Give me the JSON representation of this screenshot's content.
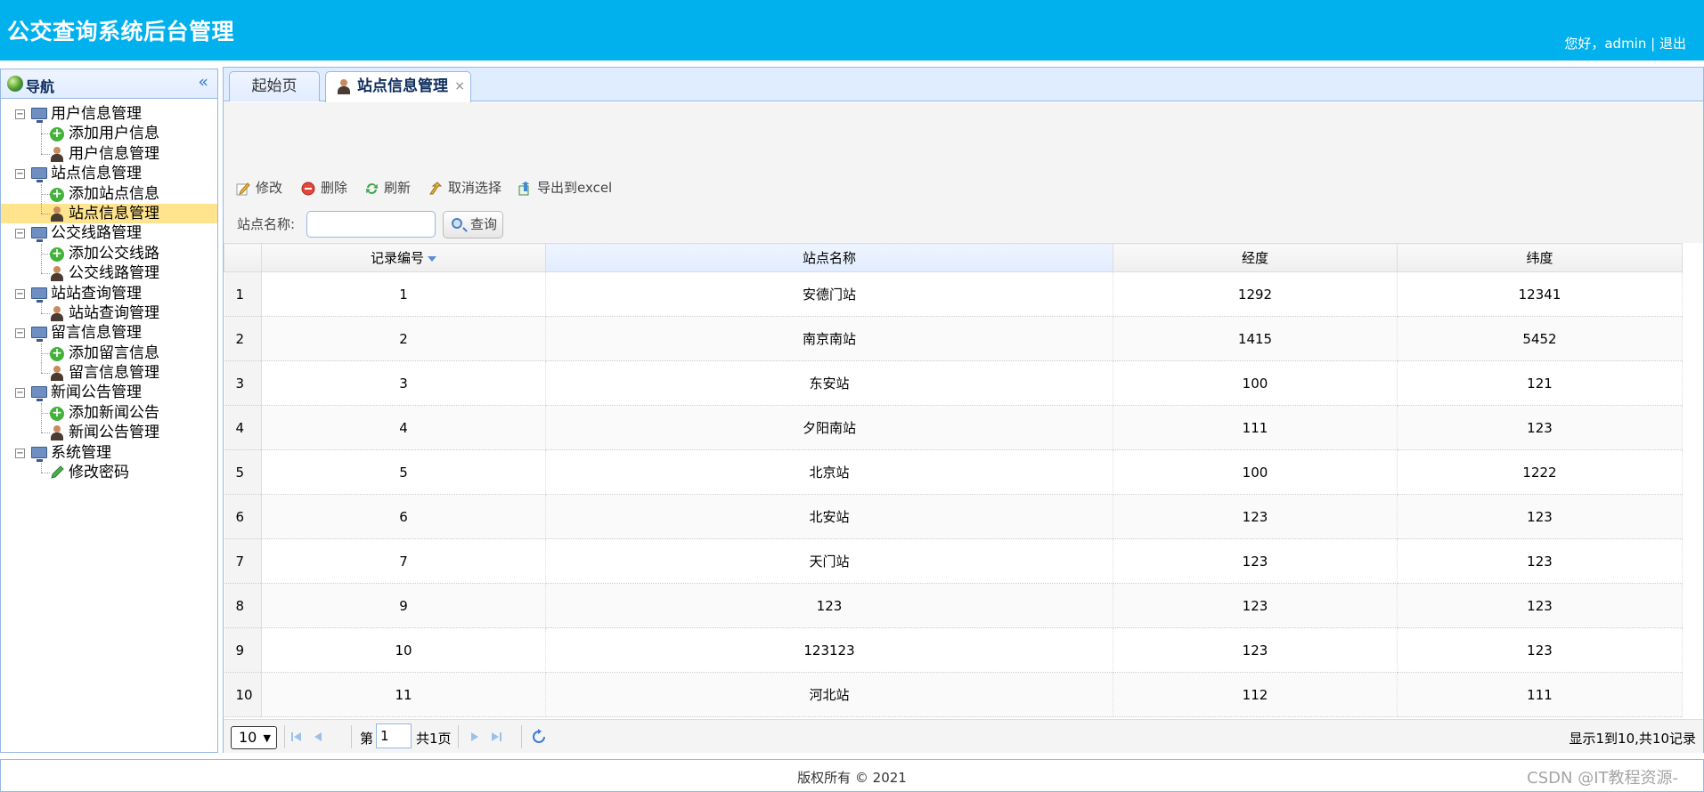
{
  "header": {
    "title": "公交查询系统后台管理",
    "greeting": "您好，admin",
    "separator": "|",
    "logout": "退出"
  },
  "sidebar": {
    "title": "导航",
    "collapse_icon": "double-chevron-left-icon",
    "groups": [
      {
        "label": "用户信息管理",
        "children": [
          {
            "label": "添加用户信息",
            "icon": "add-icon"
          },
          {
            "label": "用户信息管理",
            "icon": "user-icon"
          }
        ]
      },
      {
        "label": "站点信息管理",
        "children": [
          {
            "label": "添加站点信息",
            "icon": "add-icon"
          },
          {
            "label": "站点信息管理",
            "icon": "user-icon",
            "selected": true
          }
        ]
      },
      {
        "label": "公交线路管理",
        "children": [
          {
            "label": "添加公交线路",
            "icon": "add-icon"
          },
          {
            "label": "公交线路管理",
            "icon": "user-icon"
          }
        ]
      },
      {
        "label": "站站查询管理",
        "children": [
          {
            "label": "站站查询管理",
            "icon": "user-icon"
          }
        ]
      },
      {
        "label": "留言信息管理",
        "children": [
          {
            "label": "添加留言信息",
            "icon": "add-icon"
          },
          {
            "label": "留言信息管理",
            "icon": "user-icon"
          }
        ]
      },
      {
        "label": "新闻公告管理",
        "children": [
          {
            "label": "添加新闻公告",
            "icon": "add-icon"
          },
          {
            "label": "新闻公告管理",
            "icon": "user-icon"
          }
        ]
      },
      {
        "label": "系统管理",
        "children": [
          {
            "label": "修改密码",
            "icon": "pencil-icon"
          }
        ]
      }
    ]
  },
  "tabs": [
    {
      "label": "起始页",
      "active": false
    },
    {
      "label": "站点信息管理",
      "active": true,
      "close": "×"
    }
  ],
  "toolbar": {
    "edit": "修改",
    "delete": "删除",
    "refresh": "刷新",
    "cancel_select": "取消选择",
    "export": "导出到excel"
  },
  "search": {
    "label": "站点名称:",
    "value": "",
    "button": "查询"
  },
  "grid": {
    "columns": [
      "记录编号",
      "站点名称",
      "经度",
      "纬度"
    ],
    "rows": [
      {
        "n": "1",
        "id": "1",
        "name": "安德门站",
        "lng": "1292",
        "lat": "12341"
      },
      {
        "n": "2",
        "id": "2",
        "name": "南京南站",
        "lng": "1415",
        "lat": "5452"
      },
      {
        "n": "3",
        "id": "3",
        "name": "东安站",
        "lng": "100",
        "lat": "121"
      },
      {
        "n": "4",
        "id": "4",
        "name": "夕阳南站",
        "lng": "111",
        "lat": "123"
      },
      {
        "n": "5",
        "id": "5",
        "name": "北京站",
        "lng": "100",
        "lat": "1222"
      },
      {
        "n": "6",
        "id": "6",
        "name": "北安站",
        "lng": "123",
        "lat": "123"
      },
      {
        "n": "7",
        "id": "7",
        "name": "天门站",
        "lng": "123",
        "lat": "123"
      },
      {
        "n": "8",
        "id": "9",
        "name": "123",
        "lng": "123",
        "lat": "123"
      },
      {
        "n": "9",
        "id": "10",
        "name": "123123",
        "lng": "123",
        "lat": "123"
      },
      {
        "n": "10",
        "id": "11",
        "name": "河北站",
        "lng": "112",
        "lat": "111"
      }
    ]
  },
  "pager": {
    "page_size": "10",
    "page_prefix": "第",
    "page": "1",
    "page_total": "共1页",
    "info": "显示1到10,共10记录"
  },
  "footer": {
    "copyright": "版权所有 © 2021",
    "watermark": "CSDN @IT教程资源-"
  },
  "colors": {
    "header_bg": "#00b1ee",
    "panel_border": "#95b8e7",
    "selected_row": "#ffe48d"
  }
}
